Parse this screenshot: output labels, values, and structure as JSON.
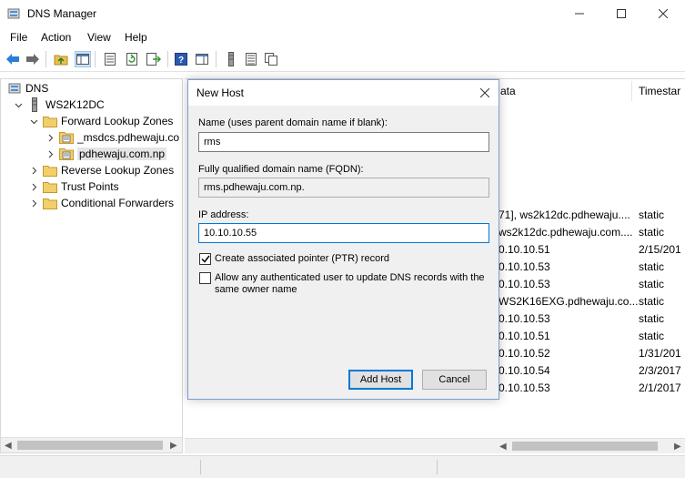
{
  "window": {
    "title": "DNS Manager"
  },
  "menu": [
    "File",
    "Action",
    "View",
    "Help"
  ],
  "toolbar_icons": [
    "back-arrow-icon",
    "forward-arrow-icon",
    "up-folder-icon",
    "show-hide-console-tree-icon",
    "properties-icon",
    "refresh-icon",
    "export-list-icon",
    "help-icon",
    "show-hide-action-pane-icon",
    "server-icon",
    "list-icon",
    "copy-icon"
  ],
  "tree": {
    "root": "DNS",
    "server": "WS2K12DC",
    "forward": "Forward Lookup Zones",
    "msdcs": "_msdcs.pdhewaju.co",
    "zone": "pdhewaju.com.np",
    "reverse": "Reverse Lookup Zones",
    "trust": "Trust Points",
    "conditional": "Conditional Forwarders"
  },
  "list": {
    "headers": {
      "data": "ata",
      "timestamp": "Timestar"
    },
    "rows": [
      {
        "data": "71], ws2k12dc.pdhewaju....",
        "ts": "static"
      },
      {
        "data": "ws2k12dc.pdhewaju.com....",
        "ts": "static"
      },
      {
        "data": "0.10.10.51",
        "ts": "2/15/201"
      },
      {
        "data": "0.10.10.53",
        "ts": "static"
      },
      {
        "data": "0.10.10.53",
        "ts": "static"
      },
      {
        "data": "WS2K16EXG.pdhewaju.co...",
        "ts": "static"
      },
      {
        "data": "0.10.10.53",
        "ts": "static"
      },
      {
        "data": "0.10.10.51",
        "ts": "static"
      },
      {
        "data": "0.10.10.52",
        "ts": "1/31/201"
      },
      {
        "data": "0.10.10.54",
        "ts": "2/3/2017"
      },
      {
        "data": "0.10.10.53",
        "ts": "2/1/2017"
      }
    ]
  },
  "dialog": {
    "title": "New Host",
    "name_label": "Name (uses parent domain name if blank):",
    "name_value": "rms",
    "fqdn_label": "Fully qualified domain name (FQDN):",
    "fqdn_value": "rms.pdhewaju.com.np.",
    "ip_label": "IP address:",
    "ip_value": "10.10.10.55",
    "ptr_label": "Create associated pointer (PTR) record",
    "ptr_checked": true,
    "allow_label": "Allow any authenticated user to update DNS records with the same owner name",
    "allow_checked": false,
    "add_button": "Add Host",
    "cancel_button": "Cancel"
  }
}
